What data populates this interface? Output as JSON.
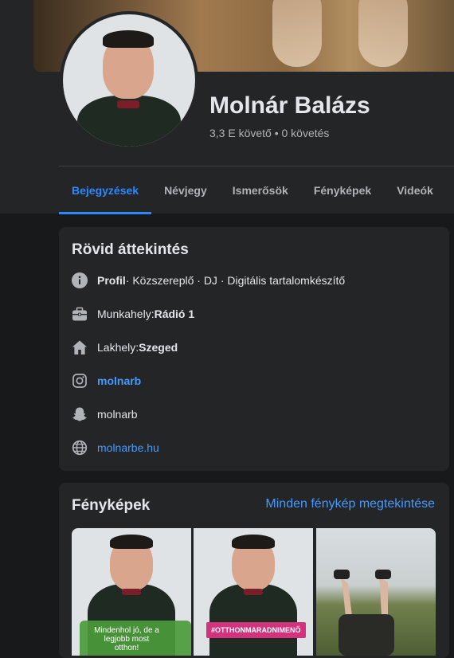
{
  "profile": {
    "name": "Molnár Balázs",
    "followers": "3,3 E követő • 0 követés"
  },
  "tabs": [
    {
      "label": "Bejegyzések",
      "active": true
    },
    {
      "label": "Névjegy"
    },
    {
      "label": "Ismerősök"
    },
    {
      "label": "Fényképek"
    },
    {
      "label": "Videók"
    }
  ],
  "intro": {
    "title": "Rövid áttekintés",
    "items": {
      "profile_prefix": "Profil",
      "profile_text": " · Közszereplő · DJ · Digitális tartalomkészítő",
      "work_prefix": "Munkahely: ",
      "work_value": "Rádió 1",
      "home_prefix": "Lakhely: ",
      "home_value": "Szeged",
      "instagram": "molnarb",
      "snapchat": "molnarb",
      "website": "molnarbe.hu"
    }
  },
  "photos": {
    "title": "Fényképek",
    "see_all": "Minden fénykép megtekintése",
    "thumb1_caption": "Mindenhol jó, de a legjobb most otthon!",
    "thumb2_tag": "#OTTHONMARADNIMENŐ"
  },
  "colors": {
    "accent": "#2d88ff",
    "link": "#4599ff",
    "card": "#242526",
    "background": "#18191a"
  }
}
